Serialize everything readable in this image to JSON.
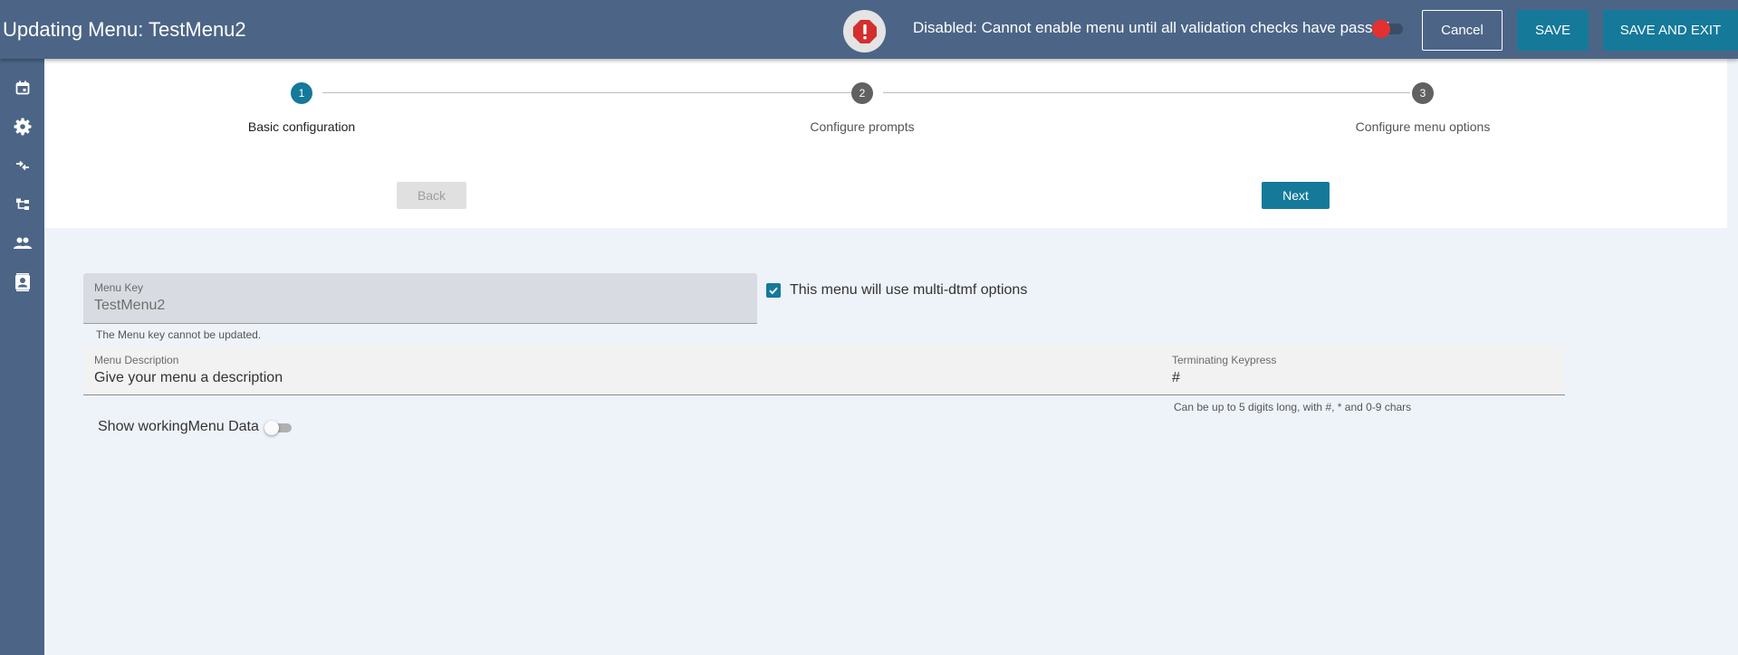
{
  "header": {
    "title": "Updating Menu: TestMenu2",
    "alert_icon": "alert-octagon-icon",
    "disabled_message": "Disabled: Cannot enable menu until all validation checks have passed",
    "enable_toggle_on": false,
    "cancel_label": "Cancel",
    "save_label": "SAVE",
    "save_exit_label": "SAVE AND EXIT",
    "colors": {
      "header_bg": "#4c6586",
      "accent": "#15799a",
      "alert_red": "#e53030"
    }
  },
  "sidebar": {
    "items": [
      {
        "icon": "calendar-icon"
      },
      {
        "icon": "gear-icon"
      },
      {
        "icon": "merge-arrows-icon"
      },
      {
        "icon": "tree-structure-icon"
      },
      {
        "icon": "people-icon"
      },
      {
        "icon": "contact-card-icon"
      }
    ]
  },
  "stepper": {
    "steps": [
      {
        "number": "1",
        "label": "Basic configuration",
        "active": true
      },
      {
        "number": "2",
        "label": "Configure prompts",
        "active": false
      },
      {
        "number": "3",
        "label": "Configure menu options",
        "active": false
      }
    ],
    "back_label": "Back",
    "next_label": "Next"
  },
  "form": {
    "menu_key": {
      "label": "Menu Key",
      "value": "TestMenu2",
      "helper": "The Menu key cannot be updated."
    },
    "multi_dtmf": {
      "label": "This menu will use multi-dtmf options",
      "checked": true
    },
    "menu_description": {
      "label": "Menu Description",
      "placeholder": "Give your menu a description"
    },
    "terminating_keypress": {
      "label": "Terminating Keypress",
      "value": "#",
      "helper": "Can be up to 5 digits long, with #, * and 0-9 chars"
    },
    "show_working_data": {
      "label": "Show workingMenu Data",
      "on": false
    }
  }
}
